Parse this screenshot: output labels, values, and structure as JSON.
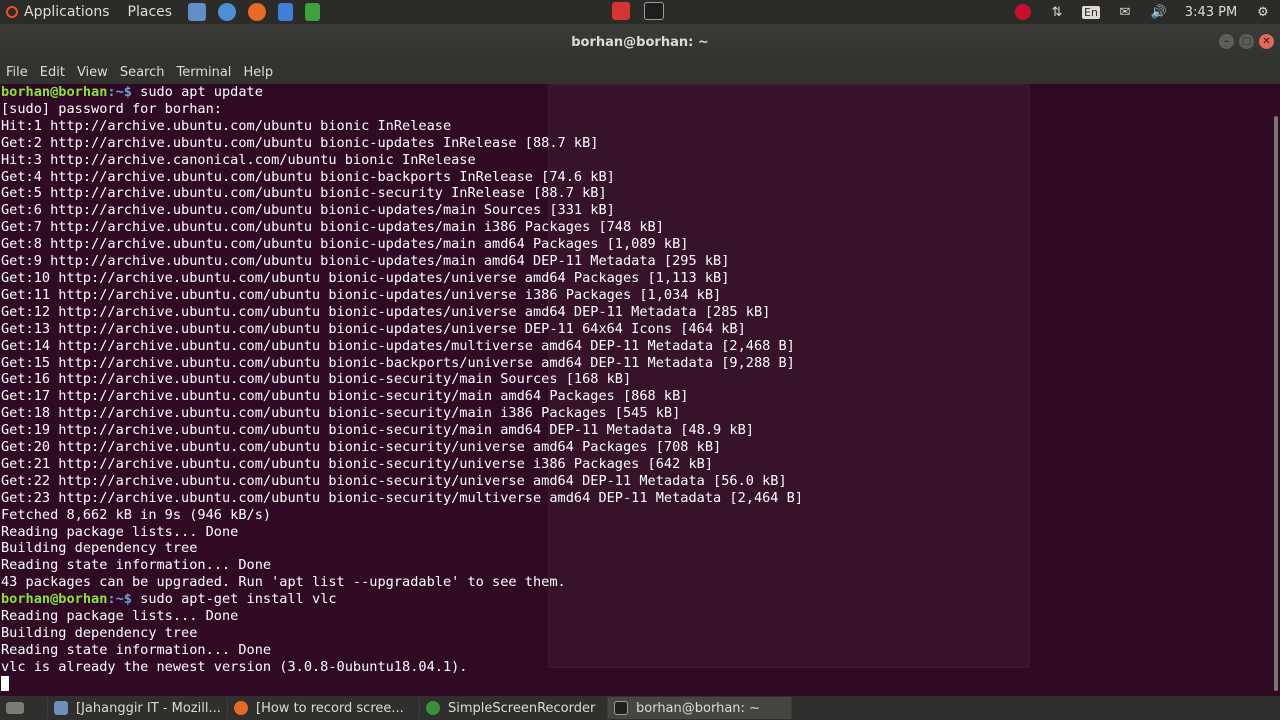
{
  "top_panel": {
    "applications": "Applications",
    "places": "Places",
    "keyboard_layout": "En",
    "clock": "3:43 PM"
  },
  "window": {
    "title": "borhan@borhan: ~",
    "menu": [
      "File",
      "Edit",
      "View",
      "Search",
      "Terminal",
      "Help"
    ]
  },
  "terminal": {
    "prompt_user": "borhan@borhan",
    "prompt_path": ":~$",
    "lines": [
      {
        "type": "prompt",
        "cmd": " sudo apt update"
      },
      {
        "type": "out",
        "text": "[sudo] password for borhan:"
      },
      {
        "type": "out",
        "text": "Hit:1 http://archive.ubuntu.com/ubuntu bionic InRelease"
      },
      {
        "type": "out",
        "text": "Get:2 http://archive.ubuntu.com/ubuntu bionic-updates InRelease [88.7 kB]"
      },
      {
        "type": "out",
        "text": "Hit:3 http://archive.canonical.com/ubuntu bionic InRelease"
      },
      {
        "type": "out",
        "text": "Get:4 http://archive.ubuntu.com/ubuntu bionic-backports InRelease [74.6 kB]"
      },
      {
        "type": "out",
        "text": "Get:5 http://archive.ubuntu.com/ubuntu bionic-security InRelease [88.7 kB]"
      },
      {
        "type": "out",
        "text": "Get:6 http://archive.ubuntu.com/ubuntu bionic-updates/main Sources [331 kB]"
      },
      {
        "type": "out",
        "text": "Get:7 http://archive.ubuntu.com/ubuntu bionic-updates/main i386 Packages [748 kB]"
      },
      {
        "type": "out",
        "text": "Get:8 http://archive.ubuntu.com/ubuntu bionic-updates/main amd64 Packages [1,089 kB]"
      },
      {
        "type": "out",
        "text": "Get:9 http://archive.ubuntu.com/ubuntu bionic-updates/main amd64 DEP-11 Metadata [295 kB]"
      },
      {
        "type": "out",
        "text": "Get:10 http://archive.ubuntu.com/ubuntu bionic-updates/universe amd64 Packages [1,113 kB]"
      },
      {
        "type": "out",
        "text": "Get:11 http://archive.ubuntu.com/ubuntu bionic-updates/universe i386 Packages [1,034 kB]"
      },
      {
        "type": "out",
        "text": "Get:12 http://archive.ubuntu.com/ubuntu bionic-updates/universe amd64 DEP-11 Metadata [285 kB]"
      },
      {
        "type": "out",
        "text": "Get:13 http://archive.ubuntu.com/ubuntu bionic-updates/universe DEP-11 64x64 Icons [464 kB]"
      },
      {
        "type": "out",
        "text": "Get:14 http://archive.ubuntu.com/ubuntu bionic-updates/multiverse amd64 DEP-11 Metadata [2,468 B]"
      },
      {
        "type": "out",
        "text": "Get:15 http://archive.ubuntu.com/ubuntu bionic-backports/universe amd64 DEP-11 Metadata [9,288 B]"
      },
      {
        "type": "out",
        "text": "Get:16 http://archive.ubuntu.com/ubuntu bionic-security/main Sources [168 kB]"
      },
      {
        "type": "out",
        "text": "Get:17 http://archive.ubuntu.com/ubuntu bionic-security/main amd64 Packages [868 kB]"
      },
      {
        "type": "out",
        "text": "Get:18 http://archive.ubuntu.com/ubuntu bionic-security/main i386 Packages [545 kB]"
      },
      {
        "type": "out",
        "text": "Get:19 http://archive.ubuntu.com/ubuntu bionic-security/main amd64 DEP-11 Metadata [48.9 kB]"
      },
      {
        "type": "out",
        "text": "Get:20 http://archive.ubuntu.com/ubuntu bionic-security/universe amd64 Packages [708 kB]"
      },
      {
        "type": "out",
        "text": "Get:21 http://archive.ubuntu.com/ubuntu bionic-security/universe i386 Packages [642 kB]"
      },
      {
        "type": "out",
        "text": "Get:22 http://archive.ubuntu.com/ubuntu bionic-security/universe amd64 DEP-11 Metadata [56.0 kB]"
      },
      {
        "type": "out",
        "text": "Get:23 http://archive.ubuntu.com/ubuntu bionic-security/multiverse amd64 DEP-11 Metadata [2,464 B]"
      },
      {
        "type": "out",
        "text": "Fetched 8,662 kB in 9s (946 kB/s)"
      },
      {
        "type": "out",
        "text": "Reading package lists... Done"
      },
      {
        "type": "out",
        "text": "Building dependency tree"
      },
      {
        "type": "out",
        "text": "Reading state information... Done"
      },
      {
        "type": "out",
        "text": "43 packages can be upgraded. Run 'apt list --upgradable' to see them."
      },
      {
        "type": "prompt",
        "cmd": " sudo apt-get install vlc"
      },
      {
        "type": "out",
        "text": "Reading package lists... Done"
      },
      {
        "type": "out",
        "text": "Building dependency tree"
      },
      {
        "type": "out",
        "text": "Reading state information... Done"
      },
      {
        "type": "out",
        "text": "vlc is already the newest version (3.0.8-0ubuntu18.04.1)."
      },
      {
        "type": "cursor"
      }
    ]
  },
  "taskbar": {
    "tasks": [
      {
        "label": "[Jahanggir IT - Mozill...",
        "icon": "window-icon"
      },
      {
        "label": "[How to record scree...",
        "icon": "firefox-icon"
      },
      {
        "label": "SimpleScreenRecorder",
        "icon": "recorder-icon"
      },
      {
        "label": "borhan@borhan: ~",
        "icon": "terminal-icon"
      }
    ]
  },
  "colors": {
    "terminal_bg": "#300a24",
    "prompt_user": "#8ae234",
    "prompt_path": "#729fcf",
    "panel_bg": "#2b2b28"
  }
}
